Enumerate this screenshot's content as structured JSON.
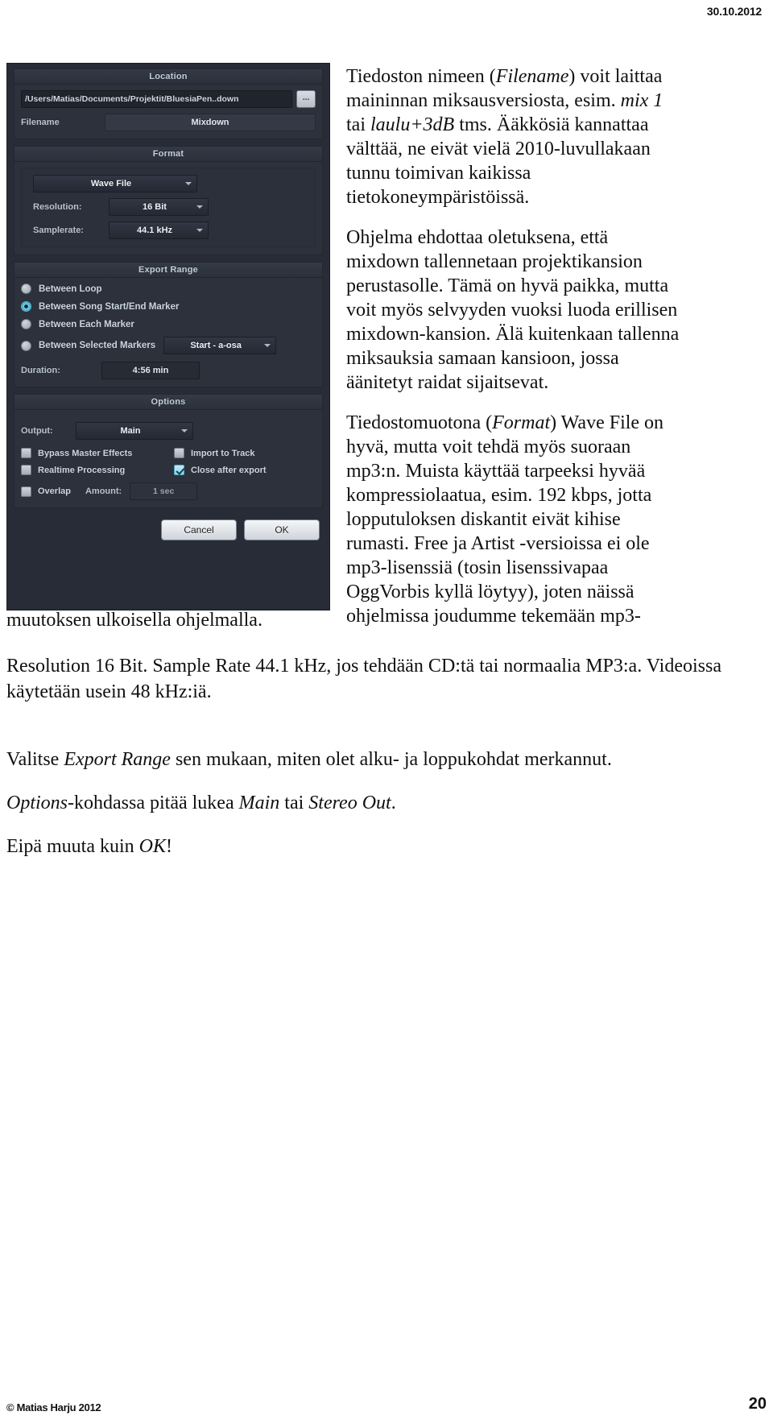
{
  "page": {
    "date": "30.10.2012",
    "footer_copyright": "© Matias Harju 2012",
    "footer_page_number": "20"
  },
  "dialog": {
    "location": {
      "title": "Location",
      "path_value": "/Users/Matias/Documents/Projektit/BluesiaPen..down",
      "browse_label": "...",
      "filename_label": "Filename",
      "filename_value": "Mixdown"
    },
    "format": {
      "title": "Format",
      "file_type": "Wave File",
      "resolution_label": "Resolution:",
      "resolution_value": "16 Bit",
      "samplerate_label": "Samplerate:",
      "samplerate_value": "44.1 kHz"
    },
    "export_range": {
      "title": "Export Range",
      "options": [
        {
          "label": "Between Loop",
          "selected": false
        },
        {
          "label": "Between Song Start/End Marker",
          "selected": true
        },
        {
          "label": "Between Each Marker",
          "selected": false
        },
        {
          "label": "Between Selected Markers",
          "selected": false
        }
      ],
      "marker_combo_value": "Start - a-osa",
      "duration_label": "Duration:",
      "duration_value": "4:56 min"
    },
    "options": {
      "title": "Options",
      "output_label": "Output:",
      "output_value": "Main",
      "checkboxes": [
        {
          "label": "Bypass Master Effects",
          "checked": false
        },
        {
          "label": "Import to Track",
          "checked": false
        },
        {
          "label": "Realtime Processing",
          "checked": false
        },
        {
          "label": "Close after export",
          "checked": true
        }
      ],
      "overlap_label": "Overlap",
      "amount_label": "Amount:",
      "amount_value": "1 sec"
    },
    "buttons": {
      "cancel": "Cancel",
      "ok": "OK"
    }
  },
  "body": {
    "para_filename_1": "Tiedoston nimeen (",
    "para_filename_em1": "Filename",
    "para_filename_2": ") voit laittaa maininnan miksausversiosta, esim. ",
    "para_filename_em2": "mix 1",
    "para_filename_3": " tai ",
    "para_filename_em3": "laulu+3dB",
    "para_filename_4": " tms. Ääkkösiä kannattaa välttää, ne eivät vielä 2010-luvullakaan tunnu toimivan kaikissa tietokoneympäristöissä.",
    "para_location": "Ohjelma ehdottaa oletuksena, että mixdown tallennetaan projektikansion perustasolle. Tämä on hyvä paikka, mutta voit myös selvyyden vuoksi luoda erillisen mixdown-kansion. Älä kuitenkaan tallenna miksauksia samaan kansioon, jossa äänitetyt raidat sijaitsevat.",
    "para_format_1": "Tiedostomuotona (",
    "para_format_em1": "Format",
    "para_format_2": ") Wave File on hyvä, mutta voit tehdä myös suoraan mp3:n. Muista käyttää tarpeeksi hyvää kompressiolaatua, esim. 192 kbps, jotta lopputuloksen diskantit eivät kihise rumasti. Free ja Artist -versioissa ei ole mp3-lisenssiä (tosin lisenssivapaa OggVorbis kyllä löytyy), joten näissä ohjelmissa joudumme tekemään mp3-",
    "para_format_tail": "muutoksen ulkoisella ohjelmalla.",
    "para_resolution": "Resolution 16 Bit. Sample Rate 44.1 kHz, jos tehdään CD:tä tai normaalia MP3:a. Videoissa käytetään usein 48 kHz:iä.",
    "para_range_1": "Valitse ",
    "para_range_em": "Export Range",
    "para_range_2": " sen mukaan, miten olet alku- ja loppukohdat merkannut.",
    "para_options_em1": "Options",
    "para_options_1": "-kohdassa pitää lukea ",
    "para_options_em2": "Main",
    "para_options_2": " tai ",
    "para_options_em3": "Stereo Out",
    "para_options_3": ".",
    "para_eipa_1": "Eipä muuta kuin ",
    "para_eipa_em": "OK",
    "para_eipa_2": "!"
  }
}
